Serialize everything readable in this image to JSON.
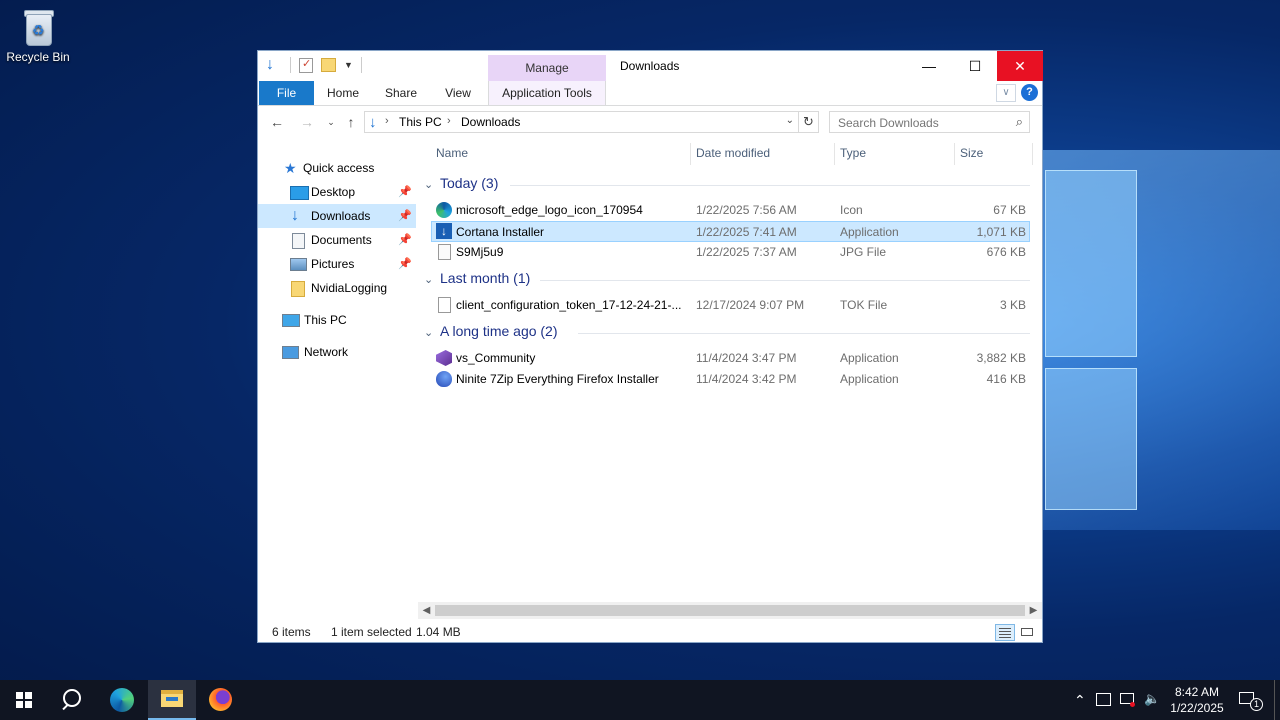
{
  "desktop": {
    "recycle_bin_label": "Recycle Bin"
  },
  "window": {
    "title": "Downloads",
    "manage_tab": "Manage",
    "ribbon_tabs": [
      "File",
      "Home",
      "Share",
      "View",
      "Application Tools"
    ]
  },
  "address": {
    "crumbs": [
      "This PC",
      "Downloads"
    ],
    "search_placeholder": "Search Downloads"
  },
  "nav": {
    "items": [
      {
        "label": "Quick access",
        "icon": "star-icon"
      },
      {
        "label": "Desktop",
        "icon": "desktop-folder-icon",
        "pinned": true
      },
      {
        "label": "Downloads",
        "icon": "download-folder-icon",
        "pinned": true,
        "selected": true
      },
      {
        "label": "Documents",
        "icon": "documents-folder-icon",
        "pinned": true
      },
      {
        "label": "Pictures",
        "icon": "pictures-folder-icon",
        "pinned": true
      },
      {
        "label": "NvidiaLogging",
        "icon": "folder-icon"
      },
      {
        "label": "This PC",
        "icon": "computer-icon"
      },
      {
        "label": "Network",
        "icon": "network-icon"
      }
    ]
  },
  "columns": [
    "Name",
    "Date modified",
    "Type",
    "Size"
  ],
  "groups": [
    {
      "title": "Today (3)"
    },
    {
      "title": "Last month (1)"
    },
    {
      "title": "A long time ago (2)"
    }
  ],
  "files": [
    {
      "name": "microsoft_edge_logo_icon_170954",
      "date": "1/22/2025 7:56 AM",
      "type": "Icon",
      "size": "67 KB",
      "icon": "edge-icon"
    },
    {
      "name": "Cortana Installer",
      "date": "1/22/2025 7:41 AM",
      "type": "Application",
      "size": "1,071 KB",
      "icon": "installer-icon",
      "selected": true
    },
    {
      "name": "S9Mj5u9",
      "date": "1/22/2025 7:37 AM",
      "type": "JPG File",
      "size": "676 KB",
      "icon": "image-file-icon"
    },
    {
      "name": "client_configuration_token_17-12-24-21-...",
      "date": "12/17/2024 9:07 PM",
      "type": "TOK File",
      "size": "3 KB",
      "icon": "file-icon"
    },
    {
      "name": "vs_Community",
      "date": "11/4/2024 3:47 PM",
      "type": "Application",
      "size": "3,882 KB",
      "icon": "visual-studio-icon"
    },
    {
      "name": "Ninite 7Zip Everything Firefox Installer",
      "date": "11/4/2024 3:42 PM",
      "type": "Application",
      "size": "416 KB",
      "icon": "ninite-icon"
    }
  ],
  "status": {
    "count": "6 items",
    "selected": "1 item selected",
    "size": "1.04 MB"
  },
  "taskbar": {
    "time": "8:42 AM",
    "date": "1/22/2025",
    "notification_count": "1"
  },
  "colors": {
    "accent": "#1979ca",
    "selection": "#cce8ff",
    "manage_tab": "#e8d5f7",
    "close": "#e81123"
  }
}
